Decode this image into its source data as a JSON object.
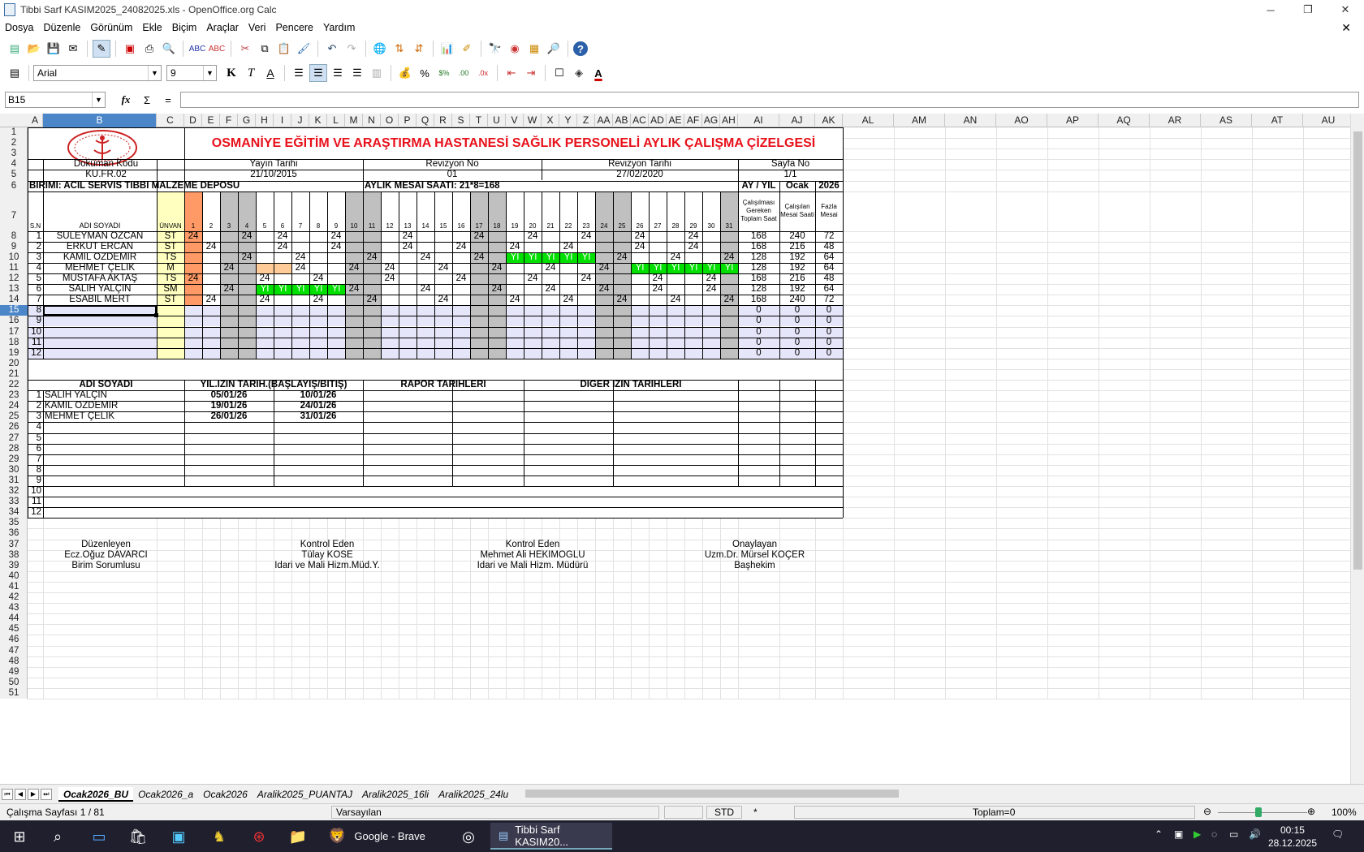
{
  "window": {
    "title": "Tibbi Sarf KASIM2025_24082025.xls - OpenOffice.org Calc",
    "minimize": "─",
    "restore": "❐",
    "close": "✕"
  },
  "menu": [
    "Dosya",
    "Düzenle",
    "Görünüm",
    "Ekle",
    "Biçim",
    "Araçlar",
    "Veri",
    "Pencere",
    "Yardım"
  ],
  "toolbar": {
    "font": "Arial",
    "size": "9",
    "bold": "K",
    "italic": "T",
    "underline": "A"
  },
  "formula": {
    "cellref": "B15",
    "fx": "fx",
    "sigma": "Σ",
    "eq": "="
  },
  "columns": [
    {
      "l": "A",
      "w": 19
    },
    {
      "l": "B",
      "w": 140
    },
    {
      "l": "C",
      "w": 34
    },
    {
      "l": "D",
      "w": 22
    },
    {
      "l": "E",
      "w": 22
    },
    {
      "l": "F",
      "w": 22
    },
    {
      "l": "G",
      "w": 22
    },
    {
      "l": "H",
      "w": 22
    },
    {
      "l": "I",
      "w": 22
    },
    {
      "l": "J",
      "w": 22
    },
    {
      "l": "K",
      "w": 22
    },
    {
      "l": "L",
      "w": 22
    },
    {
      "l": "M",
      "w": 22
    },
    {
      "l": "N",
      "w": 22
    },
    {
      "l": "O",
      "w": 22
    },
    {
      "l": "P",
      "w": 22
    },
    {
      "l": "Q",
      "w": 22
    },
    {
      "l": "R",
      "w": 22
    },
    {
      "l": "S",
      "w": 22
    },
    {
      "l": "T",
      "w": 22
    },
    {
      "l": "U",
      "w": 22
    },
    {
      "l": "V",
      "w": 22
    },
    {
      "l": "W",
      "w": 22
    },
    {
      "l": "X",
      "w": 22
    },
    {
      "l": "Y",
      "w": 22
    },
    {
      "l": "Z",
      "w": 22
    },
    {
      "l": "AA",
      "w": 22
    },
    {
      "l": "AB",
      "w": 22
    },
    {
      "l": "AC",
      "w": 22
    },
    {
      "l": "AD",
      "w": 22
    },
    {
      "l": "AE",
      "w": 22
    },
    {
      "l": "AF",
      "w": 22
    },
    {
      "l": "AG",
      "w": 22
    },
    {
      "l": "AH",
      "w": 22
    },
    {
      "l": "AI",
      "w": 51
    },
    {
      "l": "AJ",
      "w": 44
    },
    {
      "l": "AK",
      "w": 34
    },
    {
      "l": "AL",
      "w": 63
    },
    {
      "l": "AM",
      "w": 63
    },
    {
      "l": "AN",
      "w": 63
    },
    {
      "l": "AO",
      "w": 63
    },
    {
      "l": "AP",
      "w": 63
    },
    {
      "l": "AQ",
      "w": 63
    },
    {
      "l": "AR",
      "w": 63
    },
    {
      "l": "AS",
      "w": 63
    },
    {
      "l": "AT",
      "w": 63
    },
    {
      "l": "AU",
      "w": 63
    }
  ],
  "rows": [
    "1",
    "2",
    "3",
    "4",
    "5",
    "6",
    "7",
    "8",
    "9",
    "10",
    "11",
    "12",
    "13",
    "14",
    "15",
    "16",
    "17",
    "18",
    "19",
    "20",
    "21",
    "22",
    "23",
    "24",
    "25",
    "26",
    "27",
    "28",
    "29",
    "30",
    "31",
    "32",
    "33",
    "34",
    "35",
    "36",
    "37",
    "38",
    "39",
    "40",
    "41",
    "42",
    "43",
    "44",
    "45",
    "46",
    "47",
    "48",
    "49",
    "50",
    "51"
  ],
  "sheet": {
    "title": "OSMANİYE EĞİTİM VE ARAŞTIRMA HASTANESİ SAĞLIK PERSONELİ AYLIK ÇALIŞMA ÇİZELGESİ",
    "hdr4": [
      "Doküman Kodu",
      "Yayın Tarihi",
      "Revizyon No",
      "Revizyon Tarihi",
      "Sayfa No"
    ],
    "hdr5": [
      "KU.FR.02",
      "21/10/2015",
      "01",
      "27/02/2020",
      "1/1"
    ],
    "birim": "BİRİMİ: ACİL SERVİS TIBBİ MALZEME DEPOSU",
    "mesai": "AYLIK MESAİ SAATİ: 21*8=168",
    "ayyil": "AY / YIL",
    "ay": "Ocak",
    "yil": "2026",
    "sn": "S.N",
    "adsoyad": "ADI SOYADI",
    "unvan": "ÜNVAN",
    "days": [
      "1",
      "2",
      "3",
      "4",
      "5",
      "6",
      "7",
      "8",
      "9",
      "10",
      "11",
      "12",
      "13",
      "14",
      "15",
      "16",
      "17",
      "18",
      "19",
      "20",
      "21",
      "22",
      "23",
      "24",
      "25",
      "26",
      "27",
      "28",
      "29",
      "30",
      "31"
    ],
    "col_ai": "Çalışılması Gereken Toplam Saat",
    "col_aj": "Çalışılan Mesai Saati",
    "col_ak": "Fazla Mesai",
    "staff": [
      {
        "n": "1",
        "name": "SÜLEYMAN ÖZCAN",
        "t": "ST",
        "d": {
          "1": "24",
          "4": "24",
          "6": "24",
          "9": "24",
          "13": "24",
          "17": "24",
          "20": "24",
          "23": "24",
          "26": "24",
          "29": "24"
        },
        "ai": "168",
        "aj": "240",
        "ak": "72"
      },
      {
        "n": "2",
        "name": "ERKUT ERCAN",
        "t": "ST",
        "d": {
          "2": "24",
          "6": "24",
          "9": "24",
          "13": "24",
          "16": "24",
          "19": "24",
          "22": "24",
          "26": "24",
          "29": "24"
        },
        "ai": "168",
        "aj": "216",
        "ak": "48"
      },
      {
        "n": "3",
        "name": "KAMİL ÖZDEMİR",
        "t": "TS",
        "d": {
          "4": "24",
          "7": "24",
          "11": "24",
          "14": "24",
          "17": "24",
          "19": "Yİ",
          "20": "Yİ",
          "21": "Yİ",
          "22": "Yİ",
          "23": "Yİ",
          "25": "24",
          "28": "24",
          "31": "24"
        },
        "ai": "128",
        "aj": "192",
        "ak": "64"
      },
      {
        "n": "4",
        "name": "MEHMET ÇELİK",
        "t": "M",
        "d": {
          "3": "24",
          "7": "24",
          "10": "24",
          "12": "24",
          "15": "24",
          "18": "24",
          "21": "24",
          "24": "24",
          "26": "Yİ",
          "27": "Yİ",
          "28": "Yİ",
          "29": "Yİ",
          "30": "Yİ",
          "31": "Yİ"
        },
        "ai": "128",
        "aj": "192",
        "ak": "64"
      },
      {
        "n": "5",
        "name": "MUSTAFA AKTAŞ",
        "t": "TS",
        "d": {
          "1": "24",
          "5": "24",
          "8": "24",
          "12": "24",
          "16": "24",
          "20": "24",
          "23": "24",
          "27": "24",
          "30": "24"
        },
        "ai": "168",
        "aj": "216",
        "ak": "48"
      },
      {
        "n": "6",
        "name": "SALİH YALÇIN",
        "t": "SM",
        "d": {
          "3": "24",
          "5": "Yİ",
          "6": "Yİ",
          "7": "Yİ",
          "8": "Yİ",
          "9": "Yİ",
          "10": "24",
          "14": "24",
          "18": "24",
          "21": "24",
          "24": "24",
          "27": "24",
          "30": "24"
        },
        "ai": "128",
        "aj": "192",
        "ak": "64"
      },
      {
        "n": "7",
        "name": "ESABİL MERT",
        "t": "ST",
        "d": {
          "2": "24",
          "5": "24",
          "8": "24",
          "11": "24",
          "15": "24",
          "19": "24",
          "22": "24",
          "25": "24",
          "28": "24",
          "31": "24"
        },
        "ai": "168",
        "aj": "240",
        "ak": "72"
      }
    ],
    "empty_rows": [
      "8",
      "9",
      "10",
      "11",
      "12"
    ],
    "zero": "0",
    "leave_hdr": [
      "ADI SOYADI",
      "YIL.İZİN TARİH.(BAŞLAYIŞ/BİTİŞ)",
      "RAPOR TARİHLERİ",
      "DİĞER İZİN TARİHLERİ"
    ],
    "leaves": [
      {
        "n": "1",
        "name": "SALİH YALÇIN",
        "start": "05/01/26",
        "end": "10/01/26"
      },
      {
        "n": "2",
        "name": "KAMİL ÖZDEMİR",
        "start": "19/01/26",
        "end": "24/01/26"
      },
      {
        "n": "3",
        "name": "MEHMET ÇELİK",
        "start": "26/01/26",
        "end": "31/01/26"
      }
    ],
    "leave_nums": [
      "4",
      "5",
      "6",
      "7",
      "8",
      "9",
      "10",
      "11",
      "12"
    ],
    "signs": [
      {
        "role": "Düzenleyen",
        "name": "Ecz.Oğuz DAVARCI",
        "title": "Birim Sorumlusu"
      },
      {
        "role": "Kontrol Eden",
        "name": "Tülay KÖSE",
        "title": "İdari ve Mali Hizm.Müd.Y."
      },
      {
        "role": "Kontrol Eden",
        "name": "Mehmet Ali HEKİMOĞLU",
        "title": "İdari ve Mali Hizm. Müdürü"
      },
      {
        "role": "Onaylayan",
        "name": "Uzm.Dr. Mürsel KOÇER",
        "title": "Başhekim"
      }
    ]
  },
  "tabs": [
    "Ocak2026_BU",
    "Ocak2026_a",
    "Ocak2026",
    "Aralik2025_PUANTAJ",
    "Aralik2025_16li",
    "Aralik2025_24lu"
  ],
  "status": {
    "sheet": "Çalışma Sayfası 1 / 81",
    "style": "Varsayılan",
    "mode": "STD",
    "star": "*",
    "sum": "Toplam=0",
    "zoom": "100%"
  },
  "taskbar": {
    "brave": "Google - Brave",
    "calc": "Tibbi Sarf KASIM20...",
    "time": "00:15",
    "date": "28.12.2025"
  },
  "colors": {
    "title_red": "#e8111b",
    "weekend": "#c0c0c0",
    "leave_green": "#00e000",
    "day1": "#ff9966",
    "unvan_yellow": "#ffffc0",
    "empty_row": "#e6e6fa",
    "selection": "#4b86c8"
  }
}
